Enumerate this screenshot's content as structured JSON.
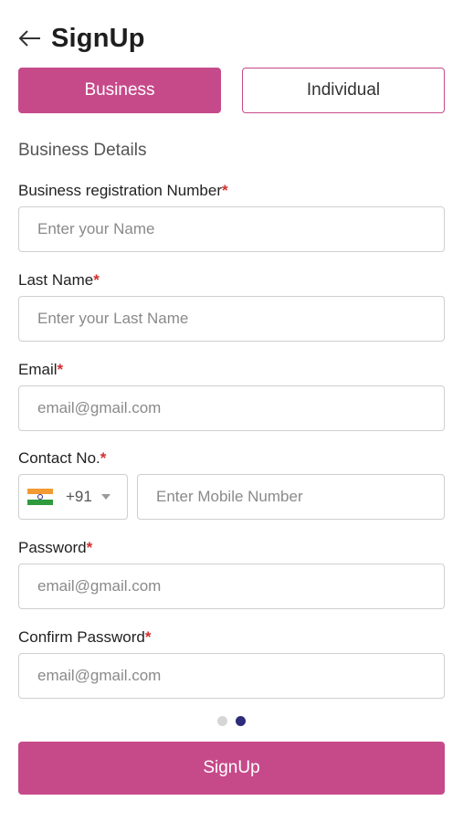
{
  "header": {
    "title": "SignUp",
    "back_icon": "arrow-left-icon"
  },
  "tabs": [
    {
      "label": "Business",
      "active": true
    },
    {
      "label": "Individual",
      "active": false
    }
  ],
  "section_title": "Business Details",
  "fields": {
    "registration": {
      "label": "Business registration Number",
      "required_mark": "*",
      "placeholder": "Enter your Name",
      "value": ""
    },
    "last_name": {
      "label": "Last Name",
      "required_mark": "*",
      "placeholder": "Enter your Last Name",
      "value": ""
    },
    "email": {
      "label": "Email",
      "required_mark": "*",
      "placeholder": "email@gmail.com",
      "value": ""
    },
    "contact": {
      "label": "Contact No.",
      "required_mark": "*",
      "country_code": "+91",
      "country_flag": "india-flag-icon",
      "placeholder": "Enter Mobile Number",
      "value": ""
    },
    "password": {
      "label": "Password",
      "required_mark": "*",
      "placeholder": "email@gmail.com",
      "value": ""
    },
    "confirm_password": {
      "label": "Confirm Password",
      "required_mark": "*",
      "placeholder": "email@gmail.com",
      "value": ""
    }
  },
  "pagination": {
    "total": 2,
    "current": 2
  },
  "submit_label": "SignUp",
  "colors": {
    "accent": "#c64a8a",
    "required": "#d23030",
    "dot_active": "#2e2b7a",
    "dot_inactive": "#d6d6d6",
    "border": "#cfcfcf"
  }
}
